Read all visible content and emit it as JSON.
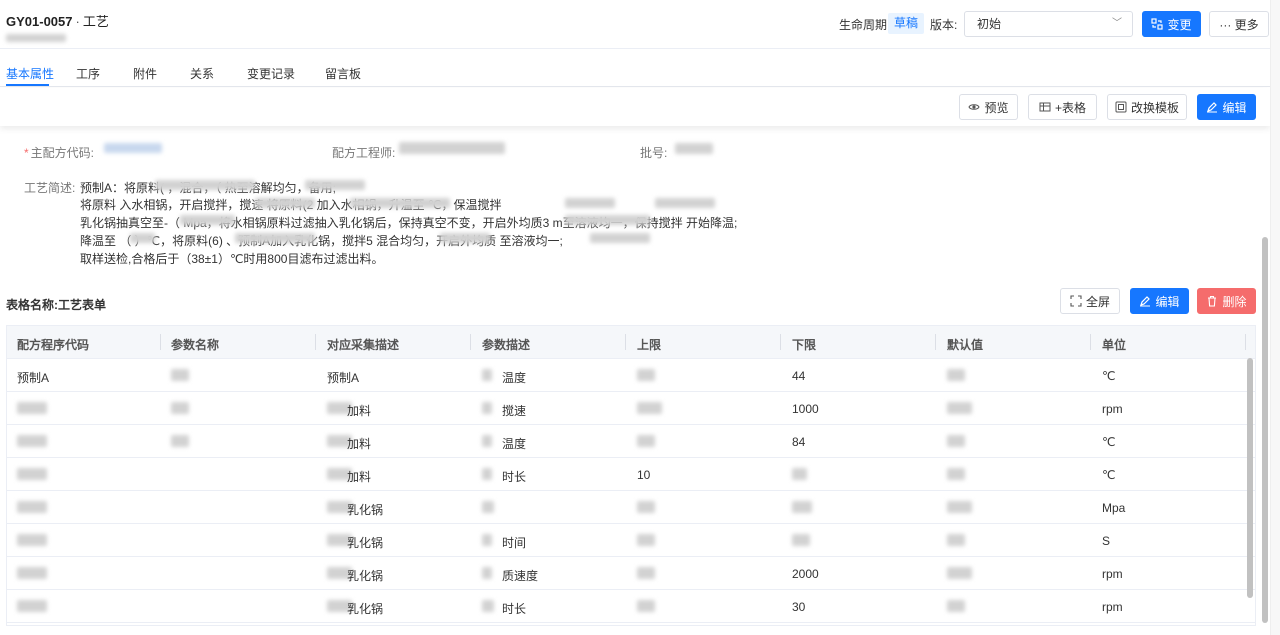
{
  "header": {
    "doc_code": "GY01-0057",
    "separator": "·",
    "doc_type": "工艺",
    "lifecycle_label": "生命周期:",
    "lifecycle_value": "草稿",
    "version_label": "版本:",
    "version_value": "初始",
    "change_button": "变更",
    "more_button": "··· 更多"
  },
  "tabs": [
    "基本属性",
    "工序",
    "附件",
    "关系",
    "变更记录",
    "留言板"
  ],
  "toolbar": {
    "preview": "预览",
    "add_table": "+表格",
    "change_template": "改换模板",
    "edit": "编辑"
  },
  "form": {
    "main_code_label": "主配方代码:",
    "engineer_label": "配方工程师:",
    "batch_label": "批号:",
    "process_label": "工艺简述:",
    "process_lines": [
      "预制A：将原料(                        ，混合，（                 热至溶解均匀，备用;",
      "将原料          入水相锅，开启搅拌，搅速              将原料(2                        加入水相锅，升温至                ℃，保温搅拌",
      "乳化锅抽真空至-（                   Mpa，将水相锅原料过滤抽入乳化锅后，保持真空不变，开启外均质3                 m至溶液均一，保持搅拌               开始降温;",
      "降温至  （          ）℃，将原料(6)                       、预制A加入乳化锅，搅拌5                 混合均匀，开启外均质                        至溶液均一;",
      "取样送检,合格后于（38±1）℃时用800目滤布过滤出料。"
    ]
  },
  "table_section": {
    "title": "表格名称:工艺表单",
    "fullscreen": "全屏",
    "edit": "编辑",
    "delete": "删除"
  },
  "table": {
    "headers": [
      "配方程序代码",
      "参数名称",
      "对应采集描述",
      "参数描述",
      "上限",
      "下限",
      "默认值",
      "单位"
    ],
    "rows": [
      [
        "预制A",
        "",
        "预制A",
        "温度",
        "",
        "44",
        "",
        "℃"
      ],
      [
        "",
        "",
        "加料",
        "搅速",
        "",
        "1000",
        "",
        "rpm"
      ],
      [
        "",
        "",
        "加料",
        "温度",
        "",
        "84",
        "",
        "℃"
      ],
      [
        "",
        "",
        "加料",
        "时长",
        "10",
        "",
        "",
        "℃"
      ],
      [
        "",
        "",
        "乳化锅",
        "",
        "",
        "",
        "",
        "Mpa"
      ],
      [
        "",
        "",
        "乳化锅",
        "时间",
        "",
        "",
        "",
        "S"
      ],
      [
        "",
        "",
        "乳化锅",
        "质速度",
        "",
        "2000",
        "",
        "rpm"
      ],
      [
        "",
        "",
        "乳化锅",
        "时长",
        "",
        "30",
        "",
        "rpm"
      ]
    ]
  },
  "colors": {
    "primary": "#1677ff",
    "danger": "#f56c6c",
    "badge_bg": "#e8f3ff"
  }
}
